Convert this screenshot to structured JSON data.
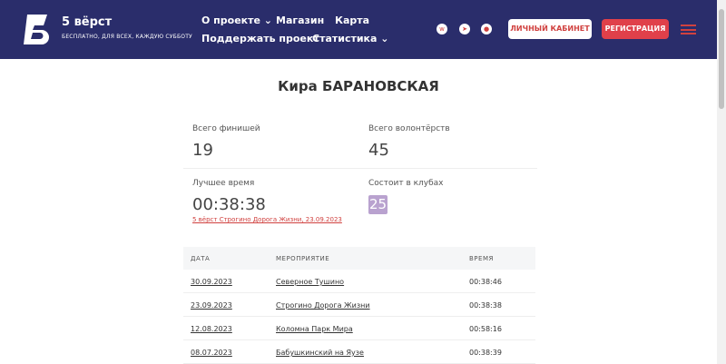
{
  "header": {
    "brand": "5 вёрст",
    "tagline": "БЕСПЛАТНО, ДЛЯ ВСЕХ, КАЖДУЮ СУББОТУ",
    "nav": [
      "О проекте ⌄",
      "Магазин",
      "Карта",
      "Поддержать проект",
      "Статистика ⌄"
    ],
    "social": [
      "vk-icon",
      "telegram-icon",
      "ok-icon"
    ],
    "cabinet": "ЛИЧНЫЙ КАБИНЕТ",
    "register": "РЕГИСТРАЦИЯ",
    "accent": "#e0404a",
    "bg": "#2a2d6b"
  },
  "profile": {
    "name": "Кира БАРАНОВСКАЯ",
    "finishes_label": "Всего финишей",
    "finishes": "19",
    "volunteer_label": "Всего волонтёрств",
    "volunteer": "45",
    "best_label": "Лучшее время",
    "best": "00:38:38",
    "best_link": "5 вёрст Строгино Дорога Жизни, 23.09.2023",
    "clubs_label": "Состоит в клубах",
    "club": "25"
  },
  "table": {
    "headers": [
      "ДАТА",
      "МЕРОПРИЯТИЕ",
      "ВРЕМЯ"
    ],
    "rows": [
      [
        "30.09.2023",
        "Северное Тушино",
        "00:38:46"
      ],
      [
        "23.09.2023",
        "Строгино Дорога Жизни",
        "00:38:38"
      ],
      [
        "12.08.2023",
        "Коломна Парк Мира",
        "00:58:16"
      ],
      [
        "08.07.2023",
        "Бабушкинский на Яузе",
        "00:38:39"
      ]
    ]
  }
}
